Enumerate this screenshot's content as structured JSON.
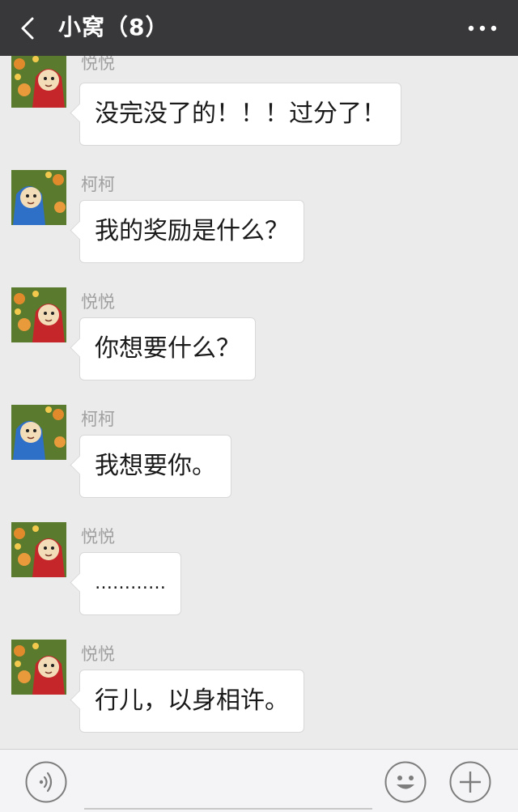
{
  "header": {
    "title": "小窝（8）",
    "back_icon": "chevron-left-icon",
    "more_icon": "more-dots-icon"
  },
  "messages": [
    {
      "sender": "悦悦",
      "avatar": "red-teletubby-avatar",
      "text": "没完没了的！！！过分了！"
    },
    {
      "sender": "柯柯",
      "avatar": "blue-teletubby-avatar",
      "text": "我的奖励是什么？"
    },
    {
      "sender": "悦悦",
      "avatar": "red-teletubby-avatar",
      "text": "你想要什么？"
    },
    {
      "sender": "柯柯",
      "avatar": "blue-teletubby-avatar",
      "text": "我想要你。"
    },
    {
      "sender": "悦悦",
      "avatar": "red-teletubby-avatar",
      "text": "…………"
    },
    {
      "sender": "悦悦",
      "avatar": "red-teletubby-avatar",
      "text": "行儿，以身相许。"
    }
  ],
  "input_bar": {
    "voice_icon": "voice-icon",
    "emoji_icon": "emoji-icon",
    "plus_icon": "plus-icon",
    "input_value": ""
  },
  "colors": {
    "header_bg": "#38383a",
    "chat_bg": "#ebebeb",
    "bubble_bg": "#ffffff",
    "red_avatar": "#c4262a",
    "blue_avatar": "#2e6fc7"
  }
}
